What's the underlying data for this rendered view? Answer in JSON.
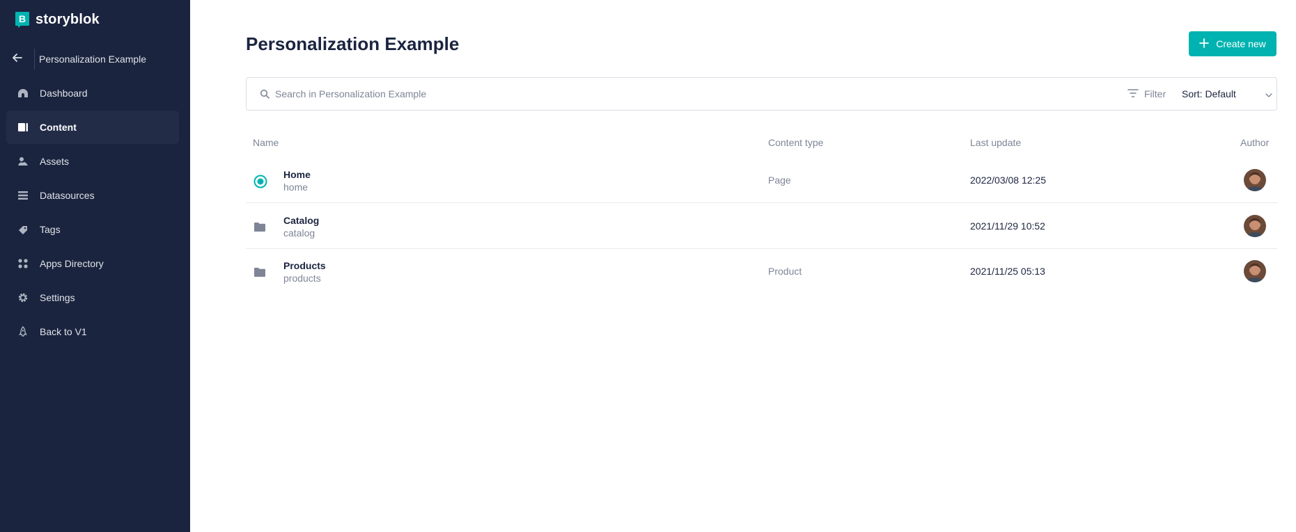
{
  "brand": {
    "name": "storyblok",
    "accent": "#00b3b0",
    "sidebar_bg": "#1b243f"
  },
  "space": {
    "name": "Personalization Example",
    "back_icon": "arrow-left-icon"
  },
  "sidebar": {
    "items": [
      {
        "label": "Dashboard",
        "icon": "dashboard-icon",
        "active": false
      },
      {
        "label": "Content",
        "icon": "content-icon",
        "active": true
      },
      {
        "label": "Assets",
        "icon": "assets-icon",
        "active": false
      },
      {
        "label": "Datasources",
        "icon": "datasources-icon",
        "active": false
      },
      {
        "label": "Tags",
        "icon": "tag-icon",
        "active": false
      },
      {
        "label": "Apps Directory",
        "icon": "apps-icon",
        "active": false
      },
      {
        "label": "Settings",
        "icon": "gear-icon",
        "active": false
      },
      {
        "label": "Back to V1",
        "icon": "rocket-icon",
        "active": false
      }
    ]
  },
  "main": {
    "title": "Personalization Example",
    "create_label": "Create new",
    "search": {
      "placeholder": "Search in Personalization Example",
      "value": ""
    },
    "filter_label": "Filter",
    "sort_label": "Sort: Default"
  },
  "table": {
    "columns": {
      "name": "Name",
      "content_type": "Content type",
      "last_update": "Last update",
      "author": "Author"
    },
    "rows": [
      {
        "title": "Home",
        "slug": "home",
        "kind": "story-icon",
        "content_type": "Page",
        "last_update": "2022/03/08 12:25"
      },
      {
        "title": "Catalog",
        "slug": "catalog",
        "kind": "folder-icon",
        "content_type": "",
        "last_update": "2021/11/29 10:52"
      },
      {
        "title": "Products",
        "slug": "products",
        "kind": "folder-icon",
        "content_type": "Product",
        "last_update": "2021/11/25 05:13"
      }
    ]
  }
}
